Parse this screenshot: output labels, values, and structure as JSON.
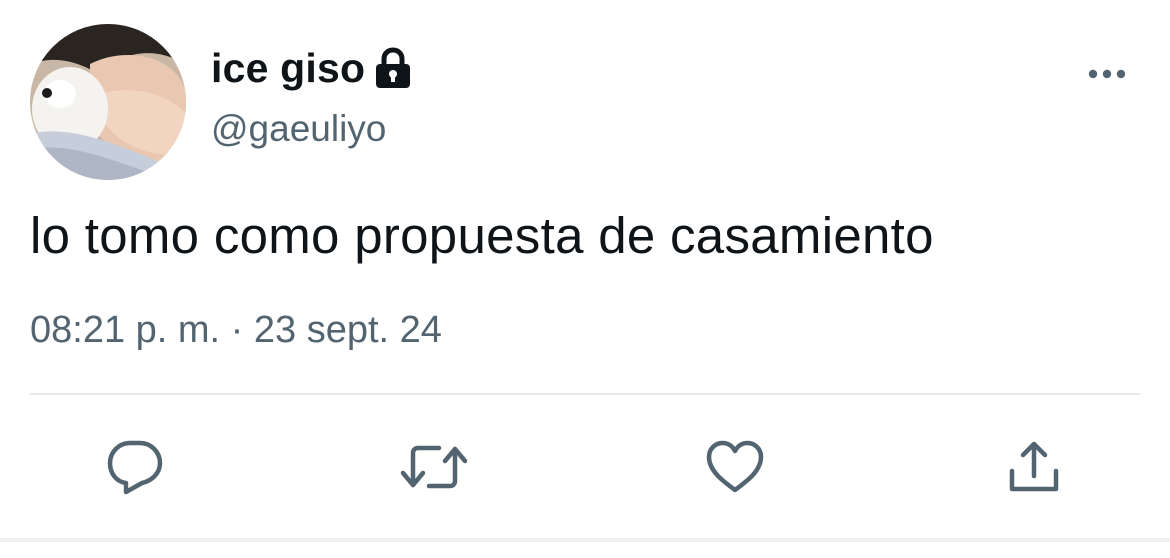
{
  "tweet": {
    "display_name": "ice giso",
    "handle": "@gaeuliyo",
    "text": "lo tomo como propuesta de casamiento",
    "timestamp": "08:21 p. m. · 23 sept. 24",
    "protected_icon": "lock-icon",
    "more_icon": "more-horizontal-icon"
  },
  "actions": [
    {
      "name": "reply",
      "icon": "reply-icon"
    },
    {
      "name": "retweet",
      "icon": "retweet-icon"
    },
    {
      "name": "like",
      "icon": "heart-icon"
    },
    {
      "name": "share",
      "icon": "share-icon"
    }
  ],
  "colors": {
    "text_primary": "#0f1419",
    "text_secondary": "#536471",
    "divider": "#e6e8ea"
  }
}
